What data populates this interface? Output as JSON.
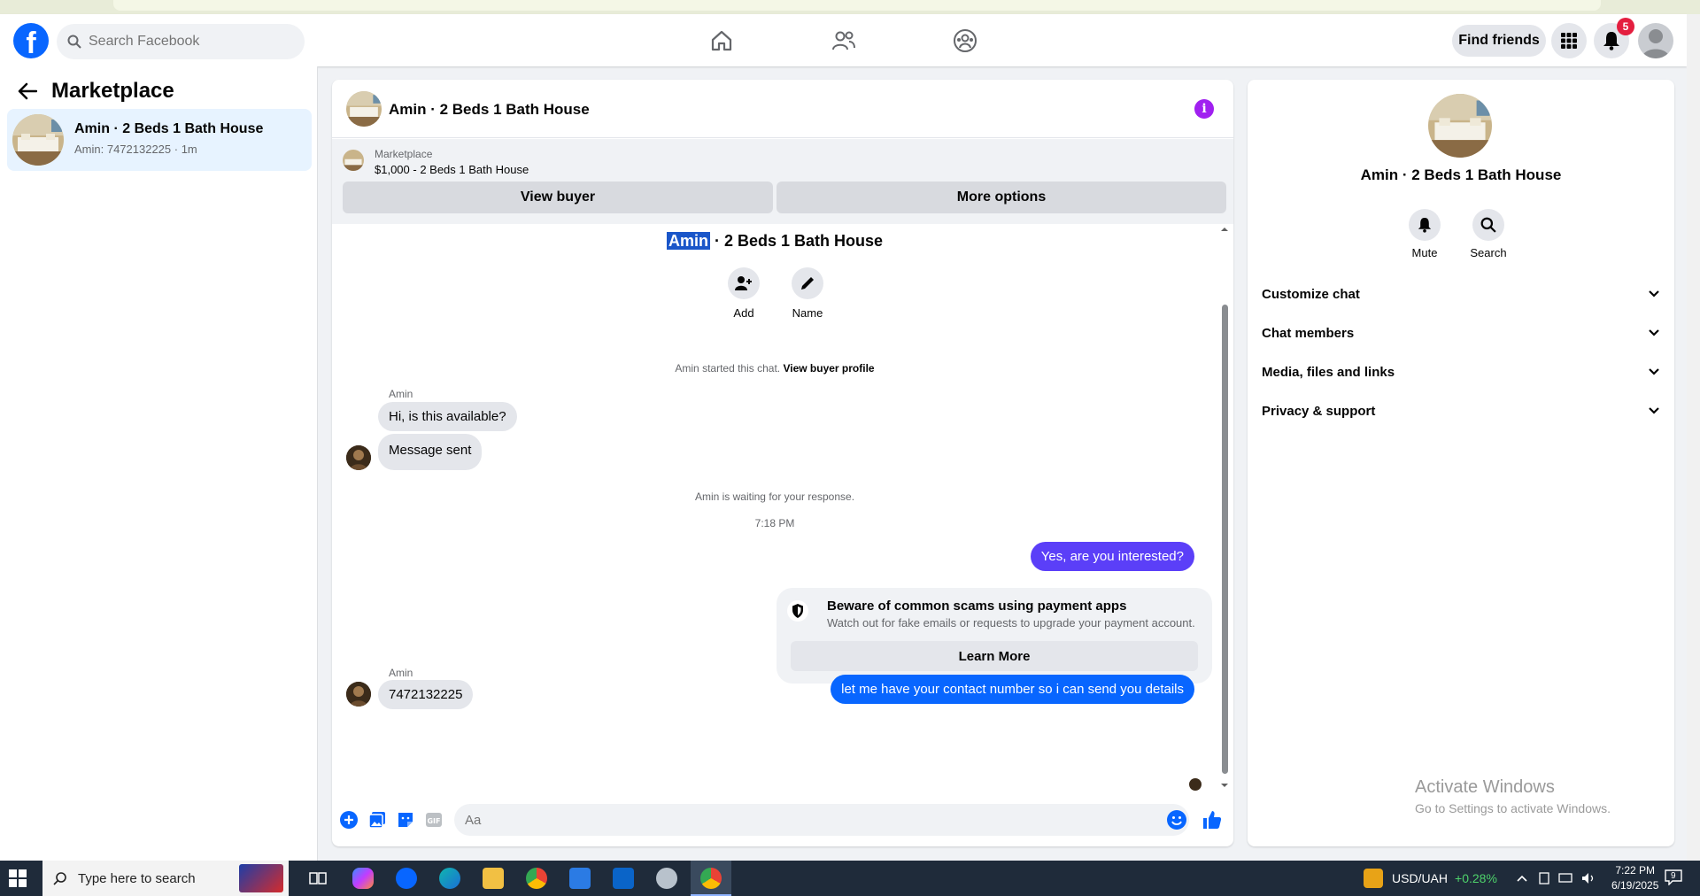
{
  "topnav": {
    "search_placeholder": "Search Facebook",
    "find_friends": "Find friends",
    "notification_count": "5"
  },
  "left": {
    "title": "Marketplace",
    "conversation": {
      "title": "Amin · 2 Beds 1 Bath House",
      "subtitle": "Amin: 7472132225 · 1m"
    }
  },
  "chat": {
    "header_title": "Amin · 2 Beds 1 Bath House",
    "listing": {
      "category": "Marketplace",
      "price_title": "$1,000 - 2 Beds 1 Bath House",
      "view_buyer": "View buyer",
      "more_options": "More options"
    },
    "center_title_highlight": "Amin",
    "center_title_rest": " · 2 Beds 1 Bath House",
    "actions": {
      "add": "Add",
      "name": "Name"
    },
    "started_text": "Amin started this chat. ",
    "view_buyer_profile": "View buyer profile",
    "messages": {
      "sender": "Amin",
      "m1": "Hi, is this available?",
      "m2": "Message sent",
      "waiting": "Amin is waiting for your response.",
      "time": "7:18 PM",
      "out1": "Yes, are you interested?",
      "out2": "let me have your contact number so i can send you details",
      "sender2": "Amin",
      "m3": "7472132225"
    },
    "scam": {
      "title": "Beware of common scams using payment apps",
      "body": "Watch out for fake emails or requests to upgrade your payment account.",
      "button": "Learn More"
    },
    "composer_placeholder": "Aa"
  },
  "right": {
    "title": "Amin · 2 Beds 1 Bath House",
    "mute": "Mute",
    "search": "Search",
    "rows": [
      "Customize chat",
      "Chat members",
      "Media, files and links",
      "Privacy & support"
    ]
  },
  "watermark": {
    "title": "Activate Windows",
    "sub": "Go to Settings to activate Windows."
  },
  "taskbar": {
    "search": "Type here to search",
    "currency": "USD/UAH",
    "change": "+0.28%",
    "time": "7:22 PM",
    "date": "6/19/2025",
    "notif": "9"
  },
  "colors": {
    "fb_blue": "#0866ff",
    "accent_purple": "#5b3ff8",
    "highlight": "#1a56c9"
  }
}
